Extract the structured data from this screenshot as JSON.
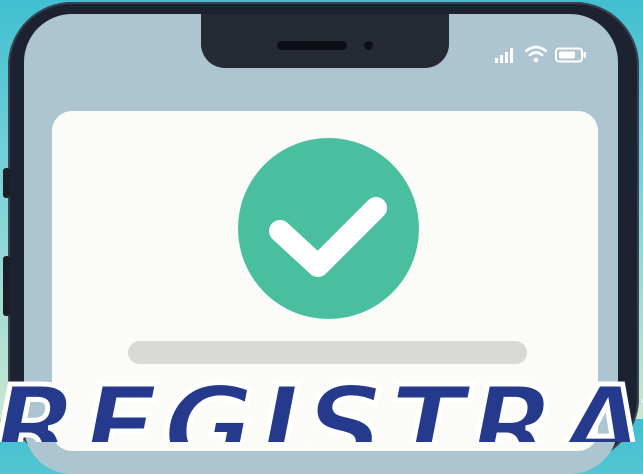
{
  "status_bar": {
    "signal_icon": "signal-bars-icon",
    "wifi_icon": "wifi-icon",
    "battery_icon": "battery-icon"
  },
  "card": {
    "icon": "checkmark-icon",
    "icon_color": "#4abf9f"
  },
  "headline": {
    "text": "REGISTRATION",
    "color": "#253a8c"
  }
}
